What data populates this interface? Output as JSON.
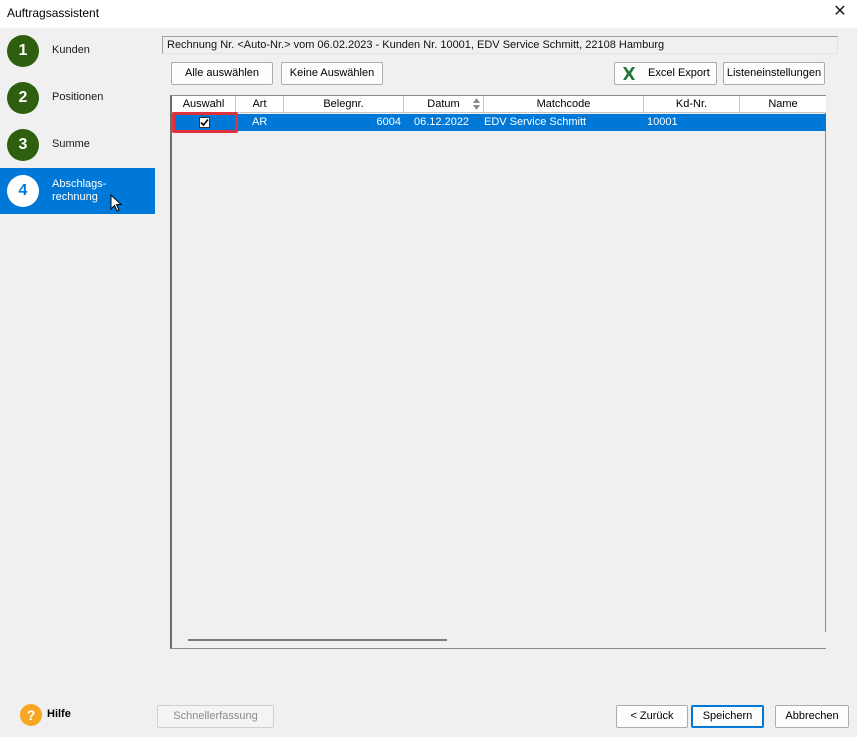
{
  "window": {
    "title": "Auftragsassistent",
    "close_glyph": "✕"
  },
  "steps": [
    {
      "number": "1",
      "label": "Kunden"
    },
    {
      "number": "2",
      "label": "Positionen"
    },
    {
      "number": "3",
      "label": "Summe"
    },
    {
      "number": "4",
      "label_line1": "Abschlags-",
      "label_line2": "rechnung",
      "active": true
    }
  ],
  "info_text": "Rechnung Nr. <Auto-Nr.> vom 06.02.2023 - Kunden Nr. 10001, EDV Service Schmitt, 22108 Hamburg",
  "toolbar": {
    "select_all": "Alle auswählen",
    "select_none": "Keine Auswählen",
    "excel_export": "Excel Export",
    "list_settings": "Listeneinstellungen",
    "excel_icon": "excel-icon"
  },
  "table": {
    "columns": [
      "Auswahl",
      "Art",
      "Belegnr.",
      "Datum",
      "Matchcode",
      "Kd-Nr.",
      "Name"
    ],
    "sorted_column": "Datum",
    "rows": [
      {
        "selected": true,
        "art": "AR",
        "belegnr": "6004",
        "datum": "06.12.2022",
        "matchcode": "EDV Service Schmitt",
        "kdnr": "10001",
        "name": ""
      }
    ]
  },
  "footer": {
    "help": "Hilfe",
    "quick_entry": "Schnellerfassung",
    "back": "< Zurück",
    "save": "Speichern",
    "cancel": "Abbrechen"
  },
  "colors": {
    "accent": "#0078d7",
    "step_green": "#2e5f0f",
    "highlight_red": "#e0323c",
    "help_orange": "#f5a623"
  }
}
